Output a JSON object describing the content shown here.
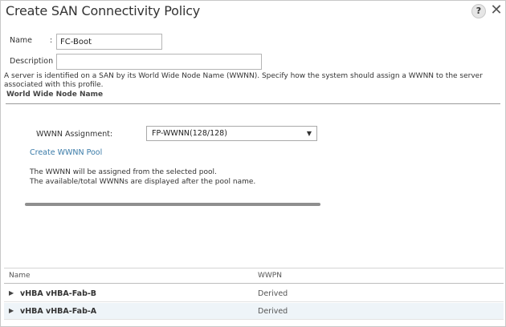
{
  "dialog": {
    "title": "Create SAN Connectivity Policy",
    "help_label": "?",
    "close_label": "✕"
  },
  "form": {
    "name_label": "Name",
    "name_value": "FC-Boot",
    "description_label": "Description :",
    "description_value": "",
    "colon": ":"
  },
  "info_text": "A server is identified on a SAN by its World Wide Node Name (WWNN). Specify how the system should assign a WWNN to the server associated with this profile.",
  "wwnn_section": {
    "header": "World Wide Node Name",
    "assignment_label": "WWNN Assignment:",
    "assignment_value": "FP-WWNN(128/128)",
    "create_pool_link": "Create WWNN Pool",
    "note_line1": "The WWNN will be assigned from the selected pool.",
    "note_line2": "The available/total WWNNs are displayed after the pool name."
  },
  "vhba_table": {
    "columns": [
      "Name",
      "WWPN"
    ],
    "rows": [
      {
        "name": "vHBA vHBA-Fab-B",
        "wwpn": "Derived"
      },
      {
        "name": "vHBA vHBA-Fab-A",
        "wwpn": "Derived"
      }
    ]
  },
  "colors": {
    "link": "#3a7ba8",
    "row_alt": "#eef4f8"
  }
}
